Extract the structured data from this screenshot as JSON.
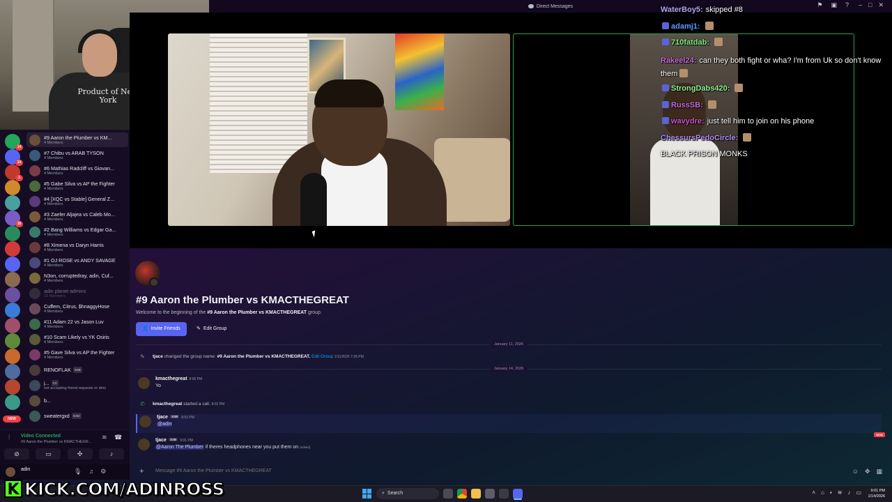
{
  "window": {
    "title": "Direct Messages"
  },
  "webcam": {
    "shirt_text": "Product of New York"
  },
  "servers": {
    "badges": [
      "14",
      "14",
      "3",
      "",
      "",
      "16",
      "",
      "",
      "",
      "",
      "",
      "",
      "",
      "",
      "",
      "",
      "",
      ""
    ],
    "new_label": "NEW",
    "colors": [
      "#23a55a",
      "#5865f2",
      "#c1392b",
      "#d08a2b",
      "#4aa0a0",
      "#7b5cc4",
      "#2b8a5c",
      "#d23a3a",
      "#5865f2",
      "#8a6b4f",
      "#6b4fa0",
      "#3a7bd5",
      "#a04f6b",
      "#5e8a3a",
      "#c86a2b",
      "#4f6ba0",
      "#b5462f",
      "#3a9a8a"
    ]
  },
  "dm_list": [
    {
      "name": "#9 Aaron the Plumber vs KM...",
      "sub": "4 Members",
      "active": true,
      "dim": false,
      "tag": ""
    },
    {
      "name": "#7 Chibu vs ARAB TYSON",
      "sub": "4 Members",
      "active": false,
      "dim": false,
      "tag": ""
    },
    {
      "name": "#6 Mathias Radcliff vs Giovan...",
      "sub": "4 Members",
      "active": false,
      "dim": false,
      "tag": ""
    },
    {
      "name": "#5 Gabe Silva vs AP the Fighter",
      "sub": "4 Members",
      "active": false,
      "dim": false,
      "tag": ""
    },
    {
      "name": "#4 [XQC vs Stable] General Z...",
      "sub": "4 Members",
      "active": false,
      "dim": false,
      "tag": ""
    },
    {
      "name": "#3 Zaefer Aljajea vs Caleb Mo...",
      "sub": "4 Members",
      "active": false,
      "dim": false,
      "tag": ""
    },
    {
      "name": "#2 Bang Williams vs Edgar Ga...",
      "sub": "4 Members",
      "active": false,
      "dim": false,
      "tag": ""
    },
    {
      "name": "#8 Ximena vs Daryn Harris",
      "sub": "4 Members",
      "active": false,
      "dim": false,
      "tag": ""
    },
    {
      "name": "#1 OJ ROSE vs ANDY SAVAGE",
      "sub": "4 Members",
      "active": false,
      "dim": false,
      "tag": ""
    },
    {
      "name": "N3on, corruptedray, adin, Cuf...",
      "sub": "4 Members",
      "active": false,
      "dim": false,
      "tag": ""
    },
    {
      "name": "adin planet admins",
      "sub": "10 Members",
      "active": false,
      "dim": true,
      "tag": ""
    },
    {
      "name": "Cuffem, Citrus, $hnaggyHose",
      "sub": "4 Members",
      "active": false,
      "dim": false,
      "tag": ""
    },
    {
      "name": "#11 Adam 22 vs Jason Luv",
      "sub": "4 Members",
      "active": false,
      "dim": false,
      "tag": ""
    },
    {
      "name": "#10 Scam Likely vs YK Osiris",
      "sub": "4 Members",
      "active": false,
      "dim": false,
      "tag": ""
    },
    {
      "name": "#5 Gave Silva vs AP the Fighter",
      "sub": "4 Members",
      "active": false,
      "dim": false,
      "tag": ""
    },
    {
      "name": "RENOFLAK",
      "sub": "",
      "active": false,
      "dim": false,
      "tag": "SSB"
    },
    {
      "name": "j...",
      "sub": "not accepting friend requests or dms",
      "active": false,
      "dim": false,
      "tag": "CV"
    },
    {
      "name": "b...",
      "sub": "",
      "active": false,
      "dim": false,
      "tag": ""
    },
    {
      "name": "sweatergxd",
      "sub": "",
      "active": false,
      "dim": false,
      "tag": "GXD"
    }
  ],
  "voice": {
    "status": "Video Connected",
    "channel": "#9 Aaron the Plumber vs KMACTHEGR..."
  },
  "user": {
    "name": "adin"
  },
  "stream_chat": [
    {
      "user": "WaterBoy5:",
      "color": "#b9a3f0",
      "text": "skipped #8",
      "icon": false,
      "emote": false
    },
    {
      "user": "adamj1:",
      "color": "#5b9bff",
      "text": "",
      "icon": true,
      "emote": true
    },
    {
      "user": "710fatdab:",
      "color": "#7cf07c",
      "text": "",
      "icon": true,
      "emote": true
    },
    {
      "user": "Rakeel24:",
      "color": "#c46bd8",
      "text": "can they both fight or wha? I'm from Uk so don't know them",
      "icon": false,
      "emote": true
    },
    {
      "user": "StrongDabs420:",
      "color": "#8ef58e",
      "text": "",
      "icon": true,
      "emote": true
    },
    {
      "user": "RussSB:",
      "color": "#c46bd8",
      "text": "",
      "icon": true,
      "emote": true
    },
    {
      "user": "wavydre:",
      "color": "#d14fd1",
      "text": "just tell him to join on his phone",
      "icon": true,
      "emote": false
    },
    {
      "user": "ChessursPedoCircle:",
      "color": "#b28ef0",
      "text": "",
      "icon": false,
      "emote": true
    },
    {
      "user": "",
      "color": "#ffffff",
      "text": "BLACK PRISON MONKS",
      "icon": false,
      "emote": false
    }
  ],
  "channel": {
    "title": "#9 Aaron the Plumber vs KMACTHEGREAT",
    "welcome_prefix": "Welcome to the beginning of the",
    "welcome_name": "#9 Aaron the Plumber vs KMACTHEGREAT",
    "welcome_suffix": "group.",
    "invite_label": "Invite Friends",
    "edit_label": "Edit Group"
  },
  "messages": {
    "date1": "January 11, 2026",
    "date2": "January 14, 2026",
    "sys_rename": {
      "user": "tjace",
      "action": "changed the group name:",
      "name": "#9 Aaron the Plumber vs KMACTHEGREAT.",
      "link": "Edit Group",
      "time": "1/11/2026 7:26 PM"
    },
    "msg1": {
      "user": "kmacthegreat",
      "time": "8:00 PM",
      "text": "Yo"
    },
    "sys_call": {
      "user": "kmacthegreat",
      "action": "started a call.",
      "time": "8:02 PM"
    },
    "msg2": {
      "user": "tjace",
      "tag": "SSB",
      "time": "8:53 PM",
      "mention": "@adin"
    },
    "msg3": {
      "user": "tjace",
      "tag": "SSB",
      "time": "9:01 PM",
      "mention": "@Aaron The Plumber",
      "text": "if theres headphones near you put them on",
      "edited": "(edited)"
    },
    "new_label": "NEW"
  },
  "composer": {
    "placeholder": "Message #9 Aaron the Plumber vs KMACTHEGREAT"
  },
  "watermark": {
    "logo": "K",
    "text": "KICK.COM/ADINROSS"
  },
  "taskbar": {
    "search": "Search",
    "time": "9:01 PM",
    "date": "1/14/2026"
  }
}
